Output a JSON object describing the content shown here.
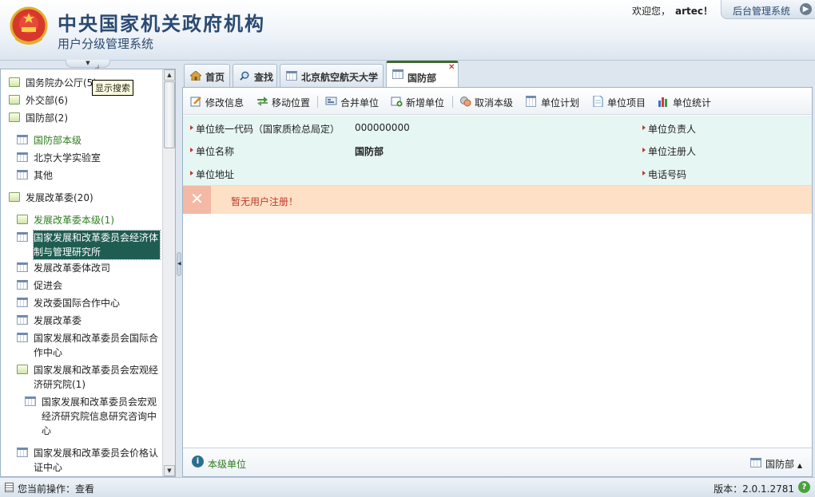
{
  "header": {
    "title": "中央国家机关政府机构",
    "subtitle": "用户分级管理系统",
    "welcome_prefix": "欢迎您，",
    "username": "artec！",
    "admin_link": "后台管理系统",
    "tooltip": "显示搜索"
  },
  "tree": {
    "items": [
      {
        "label": "国务院办公厅(5)",
        "icon": "folder-icon"
      },
      {
        "label": "外交部(6)",
        "icon": "folder-icon"
      },
      {
        "label": "国防部(2)",
        "icon": "folder-open-icon"
      },
      {
        "label": "国防部本级",
        "icon": "calendar-icon"
      },
      {
        "label": "北京大学实验室",
        "icon": "calendar-icon"
      },
      {
        "label": "其他",
        "icon": "calendar-icon"
      },
      {
        "label": "发展改革委(20)",
        "icon": "folder-open-icon"
      },
      {
        "label": "发展改革委本级(1)",
        "icon": "folder-icon"
      },
      {
        "label": "国家发展和改革委员会经济体制与管理研究所",
        "icon": "calendar-icon"
      },
      {
        "label": "发展改革委体改司",
        "icon": "calendar-icon"
      },
      {
        "label": "促进会",
        "icon": "calendar-icon"
      },
      {
        "label": "发改委国际合作中心",
        "icon": "calendar-icon"
      },
      {
        "label": "发展改革委",
        "icon": "calendar-icon"
      },
      {
        "label": "国家发展和改革委员会国际合作中心",
        "icon": "calendar-icon"
      },
      {
        "label": "国家发展和改革委员会宏观经济研究院(1)",
        "icon": "folder-open-icon"
      },
      {
        "label": "国家发展和改革委员会宏观经济研究院信息研究咨询中心",
        "icon": "calendar-icon"
      },
      {
        "label": "国家发展和改革委员会价格认证中心",
        "icon": "calendar-icon"
      }
    ]
  },
  "tabs": [
    {
      "label": "首页",
      "icon": "home-icon"
    },
    {
      "label": "查找",
      "icon": "search-icon"
    },
    {
      "label": "北京航空航天大学",
      "icon": "calendar-icon"
    },
    {
      "label": "国防部",
      "icon": "calendar-icon",
      "active": true
    }
  ],
  "toolbar": {
    "edit": "修改信息",
    "move": "移动位置",
    "merge": "合并单位",
    "add": "新增单位",
    "cancel": "取消本级",
    "plan": "单位计划",
    "project": "单位项目",
    "stats": "单位统计"
  },
  "info": {
    "code_label": "单位统一代码（国家质检总局定）",
    "code_value": "000000000",
    "name_label": "单位名称",
    "name_value": "国防部",
    "address_label": "单位地址",
    "leader_label": "单位负责人",
    "registrar_label": "单位注册人",
    "phone_label": "电话号码"
  },
  "alert": {
    "text": "暂无用户注册！"
  },
  "footer": {
    "left": "本级单位",
    "right": "国防部"
  },
  "status": {
    "operation": "您当前操作：查看",
    "version": "版本：2.0.1.2781"
  },
  "colors": {
    "accent_green": "#2e7d1e",
    "selected_bg": "#1f5d52",
    "alert_bg": "#fde0c6",
    "info_bg": "#e6f6f3"
  }
}
